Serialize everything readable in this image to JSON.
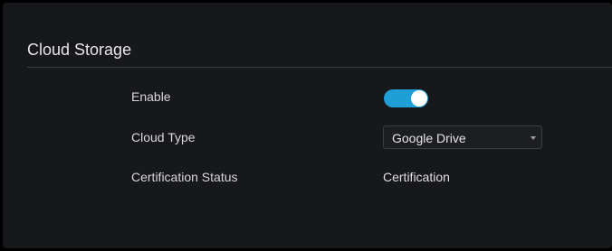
{
  "section": {
    "title": "Cloud Storage"
  },
  "rows": {
    "enable": {
      "label": "Enable",
      "state": true
    },
    "cloud_type": {
      "label": "Cloud Type",
      "selected": "Google Drive"
    },
    "certification_status": {
      "label": "Certification Status",
      "value": "Certification"
    }
  },
  "colors": {
    "accent": "#1e9fd6",
    "panel_background": "#17181b"
  },
  "icons": {
    "select_arrow": "chevron-down-icon"
  }
}
